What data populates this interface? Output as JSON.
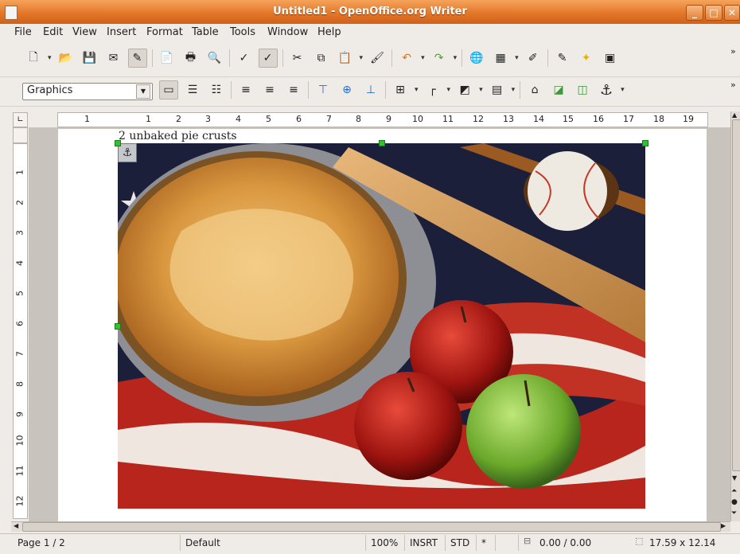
{
  "window": {
    "title": "Untitled1 - OpenOffice.org Writer",
    "minimize": "_",
    "maximize": "□",
    "close": "✕"
  },
  "menu": [
    "File",
    "Edit",
    "View",
    "Insert",
    "Format",
    "Table",
    "Tools",
    "Window",
    "Help"
  ],
  "style_box": {
    "value": "Graphics"
  },
  "ruler": {
    "labels": [
      "1",
      "1",
      "2",
      "3",
      "4",
      "5",
      "6",
      "7",
      "8",
      "9",
      "10",
      "11",
      "12",
      "13",
      "14",
      "15",
      "16",
      "17",
      "18",
      "19"
    ]
  },
  "vruler": {
    "labels": [
      "1",
      "2",
      "3",
      "4",
      "5",
      "6",
      "7",
      "8",
      "9",
      "10",
      "11",
      "12"
    ]
  },
  "document": {
    "text": "2 unbaked pie crusts"
  },
  "status": {
    "page": "Page 1 / 2",
    "style": "Default",
    "zoom": "100%",
    "insert_mode": "INSRT",
    "selection_mode": "STD",
    "modified": "*",
    "position": "0.00 / 0.00",
    "size": "17.59 x 12.14"
  },
  "colors": {
    "titlebar": "#e3772a",
    "accent": "#cf6118",
    "handle": "#2fc42f"
  }
}
